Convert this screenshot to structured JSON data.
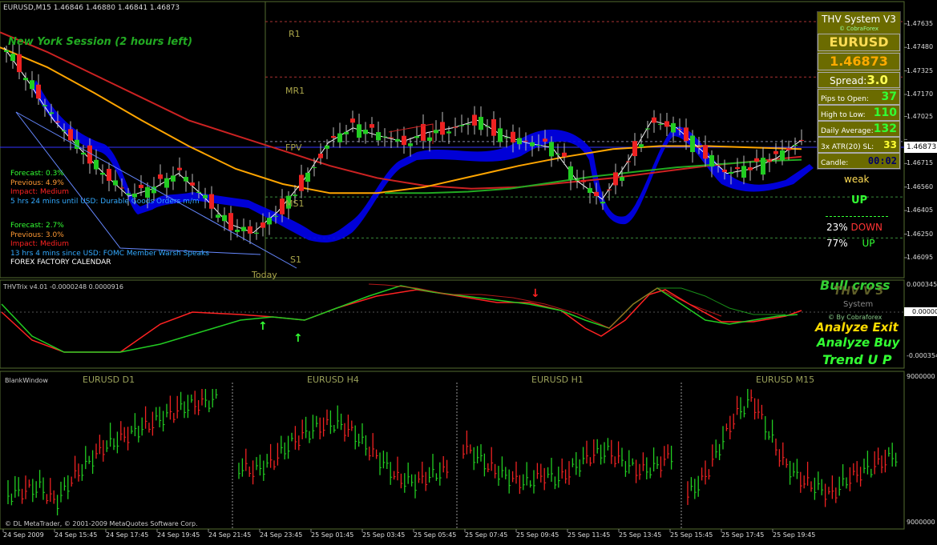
{
  "main_chart": {
    "header": "EURUSD,M15  1.46846 1.46880 1.46841 1.46873",
    "session": "New York Session (2 hours left)",
    "price_labels": [
      "1.47635",
      "1.47480",
      "1.47325",
      "1.47170",
      "1.47025",
      "1.46873",
      "1.46715",
      "1.46560",
      "1.46405",
      "1.46250",
      "1.46095"
    ],
    "current_price": "1.46873",
    "levels": [
      {
        "name": "R1",
        "price": 1.4765
      },
      {
        "name": "MR1",
        "price": 1.47285
      },
      {
        "name": "FPV",
        "price": 1.4686
      },
      {
        "name": "MS1",
        "price": 1.46495
      },
      {
        "name": "S1",
        "price": 1.46225
      }
    ],
    "today_label": "Today",
    "news": [
      {
        "forecast": "Forecast: 0.3%",
        "previous": "Previous: 4.9%",
        "impact": "Impact: Medium",
        "event": "5 hrs 24 mins until USD: Durable Goods Orders m/m"
      },
      {
        "forecast": "Forecast: 2.7%",
        "previous": "Previous: 3.0%",
        "impact": "Impact: Medium",
        "event": "13 hrs 4 mins since USD: FOMC Member Warsh Speaks"
      }
    ],
    "calendar": "FOREX FACTORY CALENDAR"
  },
  "panel": {
    "title": "THV System V3",
    "credit": "© CobraForex",
    "symbol": "EURUSD",
    "price": "1.46873",
    "spread_label": "Spread:",
    "spread_value": "3.0",
    "rows": [
      {
        "label": "Pips to Open:",
        "value": "37"
      },
      {
        "label": "High to Low:",
        "value": "110"
      },
      {
        "label": "Daily Average:",
        "value": "132"
      },
      {
        "label": "3x ATR(20) SL:",
        "value": "33"
      },
      {
        "label": "Candle:",
        "value": "00:02"
      }
    ]
  },
  "signals": {
    "strength": "weak",
    "direction": "UP",
    "down_pct": "23%",
    "down_label": "DOWN",
    "up_pct": "77%",
    "up_label": "UP"
  },
  "trix": {
    "header": "THVTrix v4.01 -0.0000248 0.0000916",
    "labels": [
      "0.000345",
      "0.00000",
      "-0.000354"
    ],
    "current": "0.00000",
    "bull_cross": "Bull cross",
    "brand": "THV V 3",
    "system": "System",
    "credit": "© By Cobraforex",
    "analyze_exit": "Analyze Exit",
    "analyze_buy": "Analyze Buy",
    "trend": "Trend U P"
  },
  "bottom": {
    "window": "BlankWindow",
    "panes": [
      "EURUSD  D1",
      "EURUSD  H4",
      "EURUSD  H1",
      "EURUSD  M15"
    ],
    "labels": [
      "9000000",
      "9000000"
    ],
    "copyright": "© DL MetaTrader, © 2001-2009 MetaQuotes Software Corp."
  },
  "time_axis": [
    "24 Sep 2009",
    "24 Sep 15:45",
    "24 Sep 17:45",
    "24 Sep 19:45",
    "24 Sep 21:45",
    "24 Sep 23:45",
    "25 Sep 01:45",
    "25 Sep 03:45",
    "25 Sep 05:45",
    "25 Sep 07:45",
    "25 Sep 09:45",
    "25 Sep 11:45",
    "25 Sep 13:45",
    "25 Sep 15:45",
    "25 Sep 17:45",
    "25 Sep 19:45"
  ],
  "colors": {
    "bull": "#22cc22",
    "bear": "#ee2222",
    "ema_orange": "#ffa500",
    "ema_red": "#cc2222",
    "ema_green": "#22aa22",
    "band": "#0000ff",
    "grid": "#556b2f"
  },
  "chart_data": {
    "type": "line",
    "title": "EURUSD,M15",
    "y_range": [
      1.46,
      1.4775
    ],
    "series": [
      {
        "name": "ema_red",
        "values": [
          1.4758,
          1.4745,
          1.473,
          1.4715,
          1.47,
          1.469,
          1.468,
          1.467,
          1.4662,
          1.4657,
          1.4655,
          1.4656,
          1.4659,
          1.4662,
          1.4666,
          1.467,
          1.4673,
          1.4676
        ]
      },
      {
        "name": "ema_orange",
        "values": [
          1.4748,
          1.4735,
          1.4718,
          1.47,
          1.4683,
          1.4668,
          1.4658,
          1.4652,
          1.4652,
          1.4656,
          1.4663,
          1.467,
          1.4676,
          1.4681,
          1.4683,
          1.4683,
          1.4682,
          1.4681
        ]
      },
      {
        "name": "ema_green",
        "values": [
          1.4652,
          1.4652,
          1.4653,
          1.4655,
          1.4659,
          1.4663,
          1.4666,
          1.4669,
          1.4671,
          1.4673,
          1.4674
        ]
      },
      {
        "name": "close",
        "values": [
          1.4748,
          1.4725,
          1.47,
          1.4682,
          1.4665,
          1.465,
          1.4655,
          1.4665,
          1.465,
          1.4632,
          1.4626,
          1.464,
          1.466,
          1.4685,
          1.4695,
          1.469,
          1.4686,
          1.4692,
          1.4695,
          1.47,
          1.469,
          1.4685,
          1.4682,
          1.466,
          1.4648,
          1.4672,
          1.47,
          1.4695,
          1.468,
          1.4665,
          1.4668,
          1.4675,
          1.4687
        ]
      }
    ]
  }
}
